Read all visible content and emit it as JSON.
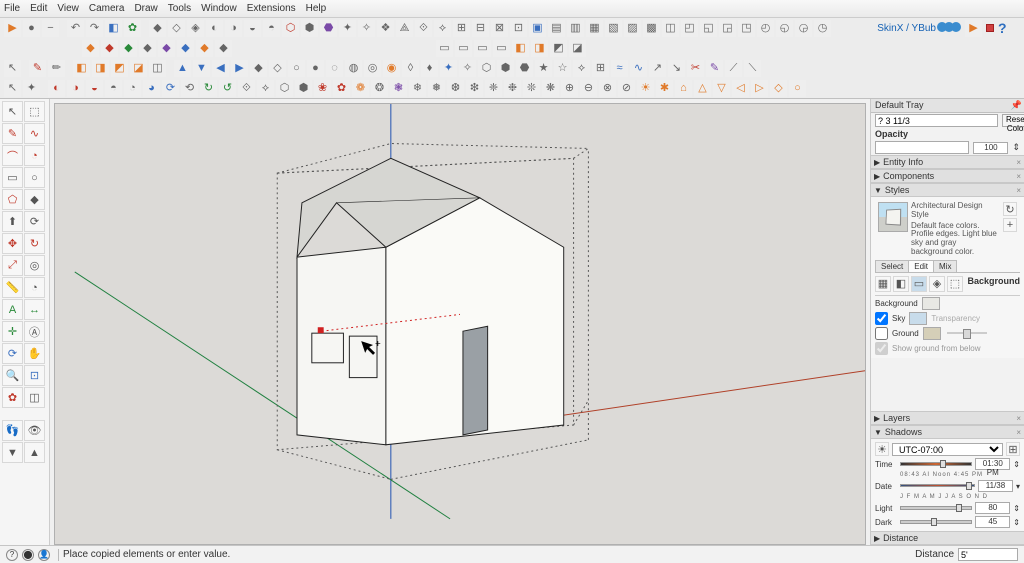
{
  "menu": [
    "File",
    "Edit",
    "View",
    "Camera",
    "Draw",
    "Tools",
    "Window",
    "Extensions",
    "Help"
  ],
  "brand": {
    "label": "SkinX / YBub"
  },
  "tray": {
    "title": "Default Tray",
    "color_field": "? 3 11/3",
    "reset": "Reset Color",
    "opacity": "Opacity",
    "opacity_val": "100"
  },
  "panels": {
    "entity": "Entity Info",
    "components": "Components",
    "styles": "Styles",
    "layers": "Layers",
    "shadows": "Shadows",
    "distance": "Distance"
  },
  "style": {
    "name": "Architectural Design Style",
    "desc": "Default face colors. Profile edges. Light blue sky and gray background color."
  },
  "style_tabs": [
    "Select",
    "Edit",
    "Mix"
  ],
  "bg": {
    "heading": "Background",
    "background": "Background",
    "sky": "Sky",
    "ground": "Ground",
    "transparency": "Transparency",
    "show_below": "Show ground from below"
  },
  "shadows": {
    "tz": "UTC-07:00",
    "time": "Time",
    "time_val": "01:30 PM",
    "time_scale": "08:43 AI  Noon  4:45 PM",
    "date": "Date",
    "date_val": "11/38",
    "date_scale": "J F M A M J J A S O N D",
    "light": "Light",
    "light_val": "80",
    "dark": "Dark",
    "dark_val": "45"
  },
  "status": {
    "hint": "Place copied elements or enter value.",
    "distance_label": "Distance",
    "distance_val": "5'"
  }
}
